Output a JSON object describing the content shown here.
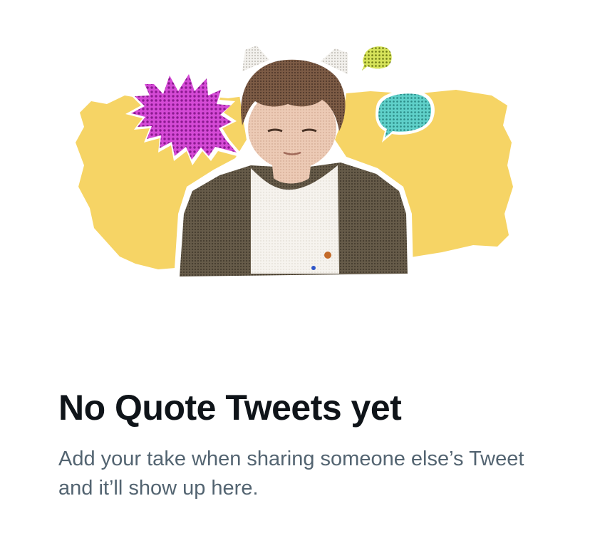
{
  "empty_state": {
    "title": "No Quote Tweets yet",
    "subtitle": "Add your take when sharing someone else’s Tweet and it’ll show up here."
  },
  "illustration": {
    "description_icon": "collage-illustration",
    "colors": {
      "yellow_paper": "#f6d465",
      "magenta_burst": "#c02bc8",
      "teal_bubble": "#49c8c2",
      "lime_bubble": "#c4d84a",
      "jacket": "#5e5444",
      "shirt": "#f4f1ec",
      "hair": "#6e5240",
      "skin": "#e8c3ad"
    }
  },
  "text_colors": {
    "title": "#0f1419",
    "subtitle": "#536471"
  }
}
